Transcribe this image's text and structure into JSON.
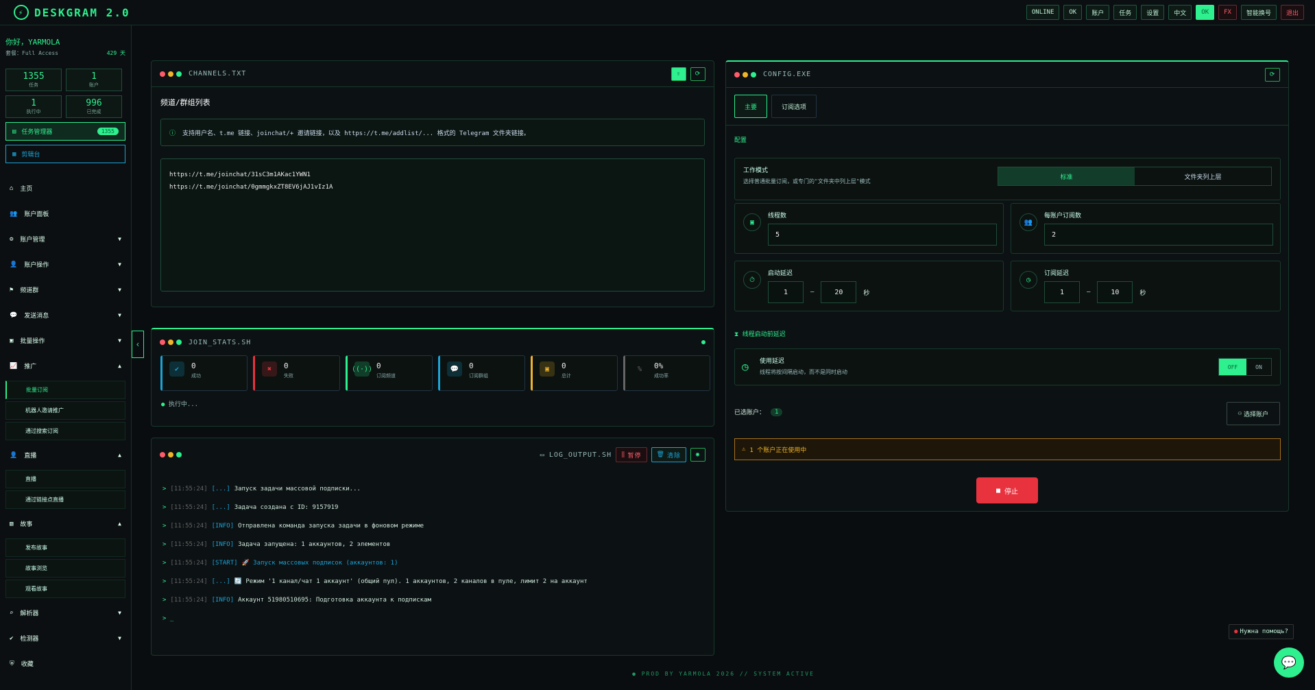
{
  "app": {
    "title": "DESKGRAM 2.0"
  },
  "topbar": [
    "ONLINE",
    "OK",
    "账户",
    "任务",
    "设置",
    "中文",
    "OK",
    "FX",
    "智能换号",
    "退出"
  ],
  "user": {
    "hello": "你好，YARMOLA",
    "plan_label": "套餐：Full Access",
    "days": "429 天"
  },
  "stats": [
    {
      "v": "1355",
      "l": "任务"
    },
    {
      "v": "1",
      "l": "账户"
    },
    {
      "v": "1",
      "l": "执行中"
    },
    {
      "v": "996",
      "l": "已完成"
    }
  ],
  "side_btns": {
    "task": "任务管理器",
    "task_count": "1355",
    "ops": "剪辑台"
  },
  "nav": {
    "home": "主页",
    "accounts": "账户面板",
    "acc_manage": "账户管理",
    "acc_ops": "账户操作",
    "channels": "频道群",
    "messages": "发送消息",
    "bulk": "批量操作",
    "promo": "推广",
    "promo_sub": [
      "批量订阅",
      "机器人邀请推广",
      "通过搜索订阅"
    ],
    "lives": "直播",
    "lives_sub": [
      "直播",
      "通过链接点直播"
    ],
    "posts": "故事",
    "posts_sub": [
      "发布故事",
      "故事浏览",
      "观看故事"
    ],
    "parser": "解析器",
    "checker": "检测器",
    "bottom": "收藏"
  },
  "channels": {
    "title": "CHANNELS.TXT",
    "heading": "频道/群组列表",
    "info": "支持用户名、t.me 链接、joinchat/+ 邀请链接，以及 https://t.me/addlist/... 格式的 Telegram 文件夹链接。",
    "text1": "https://t.me/joinchat/31sC3m1AKac1YWN1",
    "text2": "https://t.me/joinchat/0gmmgkxZT8EV6jAJ1vIz1A"
  },
  "join": {
    "title": "JOIN_STATS.SH",
    "status": "执行中...",
    "cards": [
      {
        "v": "0",
        "l": "成功"
      },
      {
        "v": "0",
        "l": "失败"
      },
      {
        "v": "0",
        "l": "订阅频道"
      },
      {
        "v": "0",
        "l": "订阅群组"
      },
      {
        "v": "0",
        "l": "总计"
      },
      {
        "v": "0%",
        "l": "成功率"
      }
    ]
  },
  "log": {
    "title": "LOG_OUTPUT.SH",
    "pause": "暂停",
    "clear": "清除",
    "lines": [
      {
        "t": "[11:55:24]",
        "k": "[...]",
        "m": "Запуск задачи массовой подписки..."
      },
      {
        "t": "[11:55:24]",
        "k": "[...]",
        "m": "Задача создана с ID: 9157919"
      },
      {
        "t": "[11:55:24]",
        "k": "[INFO]",
        "m": "Отправлена команда запуска задачи в фоновом режиме"
      },
      {
        "t": "[11:55:24]",
        "k": "[INFO]",
        "m": "Задача запущена: 1 аккаунтов, 2 элементов"
      },
      {
        "t": "[11:55:24]",
        "k": "[START]",
        "m": "🚀 Запуск массовых подписок (аккаунтов: 1)"
      },
      {
        "t": "[11:55:24]",
        "k": "[...]",
        "m": "🔄 Режим '1 канал/чат 1 аккаунт' (общий пул). 1 аккаунтов, 2 каналов в пуле, лимит 2 на аккаунт"
      },
      {
        "t": "[11:55:24]",
        "k": "[INFO]",
        "m": "Аккаунт 51980510695: Подготовка аккаунта к подпискам"
      }
    ],
    "prompt": "> _"
  },
  "config": {
    "title": "CONFIG.EXE",
    "tab1": "主要",
    "tab2": "订阅选项",
    "sec": "配置",
    "mode_label": "工作模式",
    "mode_desc": "选择普通批量订阅，或专门的\"文件夹中列上层\"模式",
    "mode_a": "标准",
    "mode_b": "文件夹列上层",
    "threads_l": "线程数",
    "threads_v": "5",
    "per_l": "每账户订阅数",
    "per_v": "2",
    "start_l": "启动延迟",
    "start_a": "1",
    "start_b": "20",
    "sub_l": "订阅延迟",
    "sub_a": "1",
    "sub_b": "10",
    "sec_u": "秒",
    "dash": "—",
    "pre": "线程启动前延迟",
    "use_delay": "使用延迟",
    "use_desc": "线程将按间隔启动，而不是同时启动",
    "off": "OFF",
    "on": "ON",
    "sel_l": "已选账户：",
    "sel_v": "1",
    "pick": "选择账户",
    "warn": "1 个账户正在使用中",
    "stop": "停止"
  },
  "footer": "● PROD BY YARMOLA 2026   // SYSTEM ACTIVE",
  "help": "Нужна помощь?"
}
